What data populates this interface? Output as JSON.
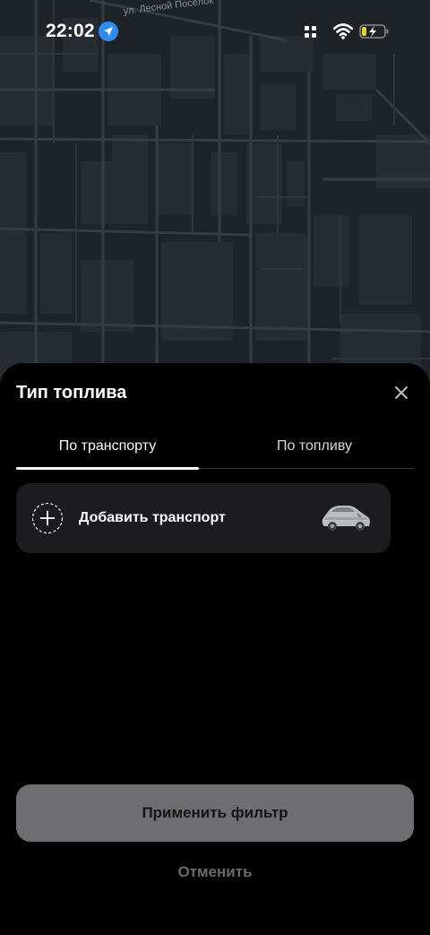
{
  "status_bar": {
    "time": "22:02",
    "street": "ул. Лесной Посёлок"
  },
  "sheet": {
    "title": "Тип топлива",
    "tabs": [
      {
        "label": "По транспорту",
        "active": true
      },
      {
        "label": "По топливу",
        "active": false
      }
    ],
    "add_vehicle_label": "Добавить транспорт",
    "apply_label": "Применить фильтр",
    "cancel_label": "Отменить"
  },
  "colors": {
    "map_bg": "#1e2327",
    "sheet_bg": "#000000",
    "card_bg": "#1c1c1e",
    "apply_bg": "#6e6e70",
    "location_accent": "#2e8cf0",
    "battery_accent": "#e3d22a"
  },
  "icons": {
    "location": "location-arrow-icon",
    "signal": "cellular-signal-icon",
    "wifi": "wifi-icon",
    "battery": "battery-charging-icon",
    "close": "close-icon",
    "plus": "plus-circle-icon",
    "car": "car-icon"
  }
}
